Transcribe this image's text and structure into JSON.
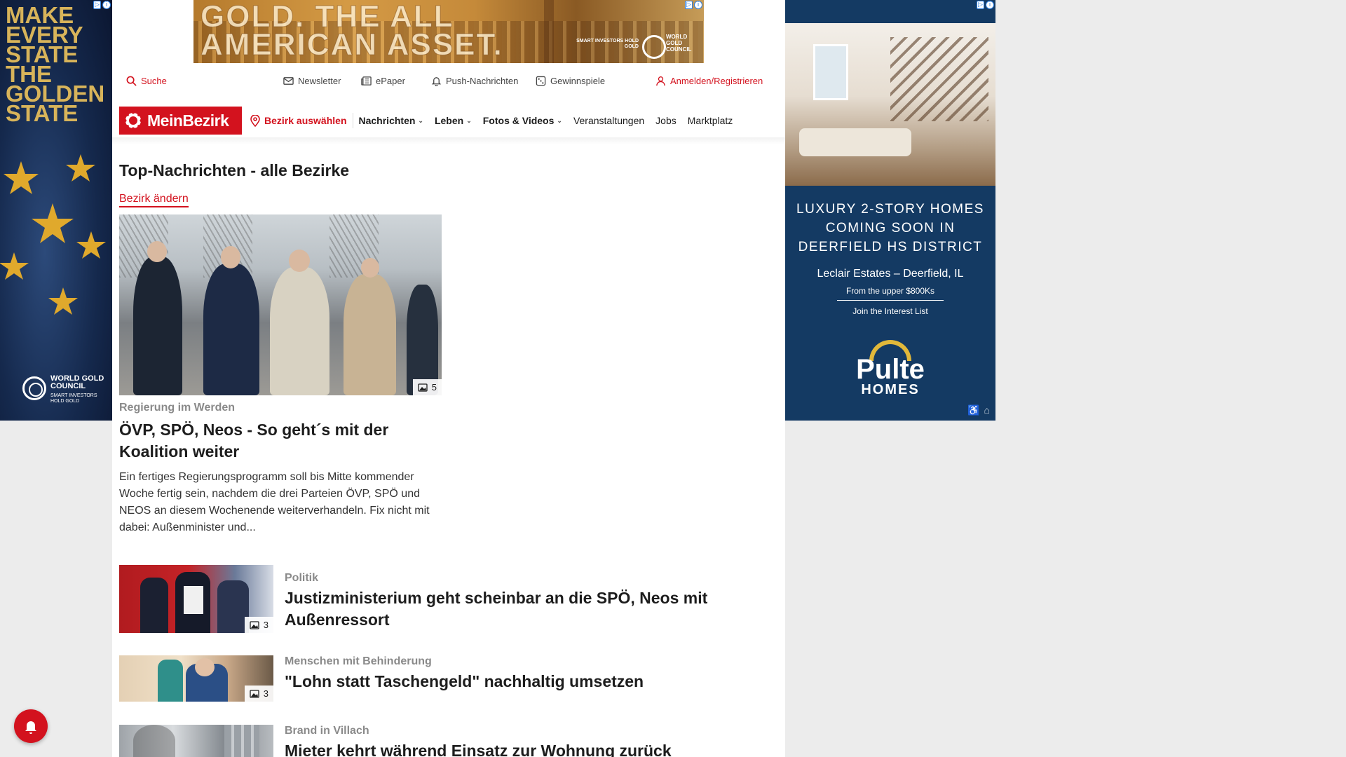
{
  "ads": {
    "left": {
      "headline": "MAKE EVERY STATE THE GOLDEN STATE",
      "brand": "WORLD GOLD COUNCIL",
      "brand_tagline": "SMART INVESTORS HOLD GOLD"
    },
    "top": {
      "line1": "GOLD. THE ALL",
      "line2": "AMERICAN ASSET.",
      "tagline": "SMART INVESTORS HOLD GOLD",
      "brand": "WORLD GOLD COUNCIL"
    },
    "right": {
      "headline": "LUXURY 2-STORY HOMES COMING SOON IN DEERFIELD HS DISTRICT",
      "estate": "Leclair Estates – Deerfield, IL",
      "price": "From the upper $800Ks",
      "cta": "Join the Interest List",
      "brand_top": "Pulte",
      "brand_bottom": "HOMES"
    }
  },
  "utility": {
    "search": "Suche",
    "newsletter": "Newsletter",
    "epaper": "ePaper",
    "push": "Push-Nachrichten",
    "gewinnspiele": "Gewinnspiele",
    "login": "Anmelden/Registrieren"
  },
  "nav": {
    "logo": "MeinBezirk",
    "bezirk": "Bezirk auswählen",
    "items": [
      {
        "label": "Nachrichten"
      },
      {
        "label": "Leben"
      },
      {
        "label": "Fotos & Videos"
      },
      {
        "label": "Veranstaltungen"
      },
      {
        "label": "Jobs"
      },
      {
        "label": "Marktplatz"
      }
    ]
  },
  "page": {
    "title": "Top-Nachrichten - alle Bezirke",
    "change_bezirk": "Bezirk ändern"
  },
  "hero": {
    "photo_count": "5",
    "kicker": "Regierung im Werden",
    "title": "ÖVP, SPÖ, Neos - So geht´s mit der Koalition weiter",
    "teaser": "Ein fertiges Regierungsprogramm soll bis Mitte kommender Woche fertig sein, nachdem die drei Parteien ÖVP, SPÖ und NEOS an diesem Wochenende weiterverhandeln. Fix nicht mit dabei: Außenminister und..."
  },
  "stories": [
    {
      "kicker": "Politik",
      "title": "Justizministerium geht scheinbar an die SPÖ, Neos mit Außenressort",
      "photo_count": "3"
    },
    {
      "kicker": "Menschen mit Behinderung",
      "title": "\"Lohn statt Taschengeld\" nachhaltig umsetzen",
      "photo_count": "3"
    },
    {
      "kicker": "Brand in Villach",
      "title": "Mieter kehrt während Einsatz zur Wohnung zurück",
      "photo_count": ""
    }
  ],
  "colors": {
    "brand_red": "#d3121e",
    "kicker_gray": "#8a8a8a",
    "ad_navy": "#143a63"
  }
}
